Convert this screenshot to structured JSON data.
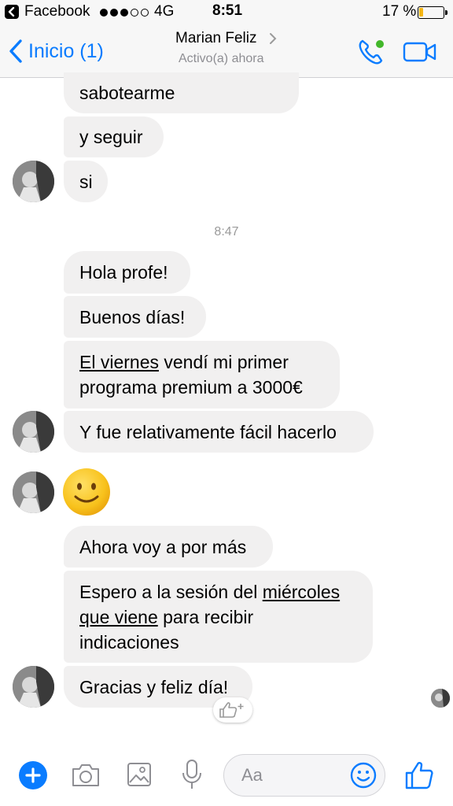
{
  "status_bar": {
    "app": "Facebook",
    "network": "4G",
    "time": "8:51",
    "battery": "17 %"
  },
  "nav": {
    "back_label": "Inicio (1)",
    "title": "Marian Feliz",
    "status": "Activo(a) ahora",
    "accent_color": "#0a7cff"
  },
  "messages": [
    {
      "parts": [
        {
          "text": "sabotearme"
        }
      ]
    },
    {
      "parts": [
        {
          "text": "y seguir"
        }
      ]
    },
    {
      "parts": [
        {
          "text": "si"
        }
      ]
    },
    {
      "parts": [
        {
          "text": "Hola profe!"
        }
      ]
    },
    {
      "parts": [
        {
          "text": "Buenos días!"
        }
      ]
    },
    {
      "parts": [
        {
          "text": "El viernes",
          "underline": true
        },
        {
          "text": " vendí mi primer programa premium a 3000€"
        }
      ]
    },
    {
      "parts": [
        {
          "text": "Y fue relativamente fácil hacerlo"
        }
      ]
    },
    {
      "parts": [
        {
          "text": "Ahora voy a por más"
        }
      ]
    },
    {
      "parts": [
        {
          "text": "Espero a la sesión del "
        },
        {
          "text": "miércoles que viene",
          "underline": true
        },
        {
          "text": " para recibir indicaciones"
        }
      ]
    },
    {
      "parts": [
        {
          "text": "Gracias y feliz día!"
        }
      ]
    }
  ],
  "timestamp": "8:47",
  "emoji_message": "slightly-smiling-face",
  "composer": {
    "placeholder": "Aa",
    "icons": [
      "plus-icon",
      "camera-icon",
      "gallery-icon",
      "microphone-icon",
      "emoji-icon",
      "thumbs-up-icon"
    ]
  },
  "colors": {
    "bubble": "#f1f0f0",
    "timestamp": "#9a9a9a"
  }
}
